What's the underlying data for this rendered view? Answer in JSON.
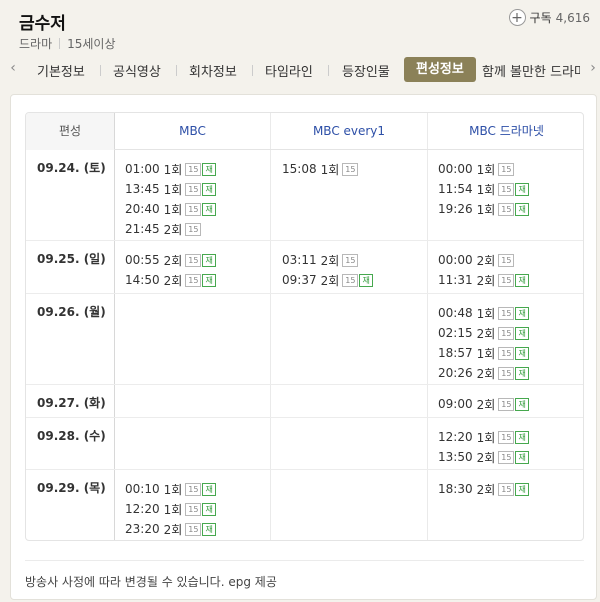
{
  "header": {
    "title": "금수저",
    "genre": "드라마",
    "rating": "15세이상",
    "subscribe_label": "구독",
    "subscribe_count": "4,616"
  },
  "tabs": [
    {
      "label": "기본정보"
    },
    {
      "label": "공식영상"
    },
    {
      "label": "회차정보"
    },
    {
      "label": "타임라인"
    },
    {
      "label": "등장인물"
    },
    {
      "label": "편성정보"
    },
    {
      "label": "함께 볼만한 드라마"
    }
  ],
  "active_tab": "편성정보",
  "schedule": {
    "columns": [
      "편성",
      "MBC",
      "MBC every1",
      "MBC 드라마넷"
    ],
    "rows": [
      {
        "date": "09.24. (토)",
        "channels": [
          [
            {
              "time": "01:00",
              "ep": "1회",
              "rating": "15",
              "re": "재"
            },
            {
              "time": "13:45",
              "ep": "1회",
              "rating": "15",
              "re": "재"
            },
            {
              "time": "20:40",
              "ep": "1회",
              "rating": "15",
              "re": "재"
            },
            {
              "time": "21:45",
              "ep": "2회",
              "rating": "15",
              "re": ""
            }
          ],
          [
            {
              "time": "15:08",
              "ep": "1회",
              "rating": "15",
              "re": ""
            }
          ],
          [
            {
              "time": "00:00",
              "ep": "1회",
              "rating": "15",
              "re": ""
            },
            {
              "time": "11:54",
              "ep": "1회",
              "rating": "15",
              "re": "재"
            },
            {
              "time": "19:26",
              "ep": "1회",
              "rating": "15",
              "re": "재"
            }
          ]
        ]
      },
      {
        "date": "09.25. (일)",
        "channels": [
          [
            {
              "time": "00:55",
              "ep": "2회",
              "rating": "15",
              "re": "재"
            },
            {
              "time": "14:50",
              "ep": "2회",
              "rating": "15",
              "re": "재"
            }
          ],
          [
            {
              "time": "03:11",
              "ep": "2회",
              "rating": "15",
              "re": ""
            },
            {
              "time": "09:37",
              "ep": "2회",
              "rating": "15",
              "re": "재"
            }
          ],
          [
            {
              "time": "00:00",
              "ep": "2회",
              "rating": "15",
              "re": ""
            },
            {
              "time": "11:31",
              "ep": "2회",
              "rating": "15",
              "re": "재"
            }
          ]
        ]
      },
      {
        "date": "09.26. (월)",
        "channels": [
          [],
          [],
          [
            {
              "time": "00:48",
              "ep": "1회",
              "rating": "15",
              "re": "재"
            },
            {
              "time": "02:15",
              "ep": "2회",
              "rating": "15",
              "re": "재"
            },
            {
              "time": "18:57",
              "ep": "1회",
              "rating": "15",
              "re": "재"
            },
            {
              "time": "20:26",
              "ep": "2회",
              "rating": "15",
              "re": "재"
            }
          ]
        ]
      },
      {
        "date": "09.27. (화)",
        "channels": [
          [],
          [],
          [
            {
              "time": "09:00",
              "ep": "2회",
              "rating": "15",
              "re": "재"
            }
          ]
        ]
      },
      {
        "date": "09.28. (수)",
        "channels": [
          [],
          [],
          [
            {
              "time": "12:20",
              "ep": "1회",
              "rating": "15",
              "re": "재"
            },
            {
              "time": "13:50",
              "ep": "2회",
              "rating": "15",
              "re": "재"
            }
          ]
        ]
      },
      {
        "date": "09.29. (목)",
        "channels": [
          [
            {
              "time": "00:10",
              "ep": "1회",
              "rating": "15",
              "re": "재"
            },
            {
              "time": "12:20",
              "ep": "1회",
              "rating": "15",
              "re": "재"
            },
            {
              "time": "23:20",
              "ep": "2회",
              "rating": "15",
              "re": "재"
            }
          ],
          [],
          [
            {
              "time": "18:30",
              "ep": "2회",
              "rating": "15",
              "re": "재"
            }
          ]
        ]
      }
    ]
  },
  "footer_note": "방송사 사정에 따라 변경될 수 있습니다. epg 제공",
  "colors": {
    "active_tab_bg": "#8b8158",
    "channel_header": "#2d4fa7",
    "rerun_badge": "#2f9a38",
    "page_bg": "#f4f2ec"
  },
  "icons": {
    "subscribe": "plus-circle-icon",
    "tabs_prev": "chevron-left-icon",
    "tabs_next": "chevron-right-icon"
  }
}
